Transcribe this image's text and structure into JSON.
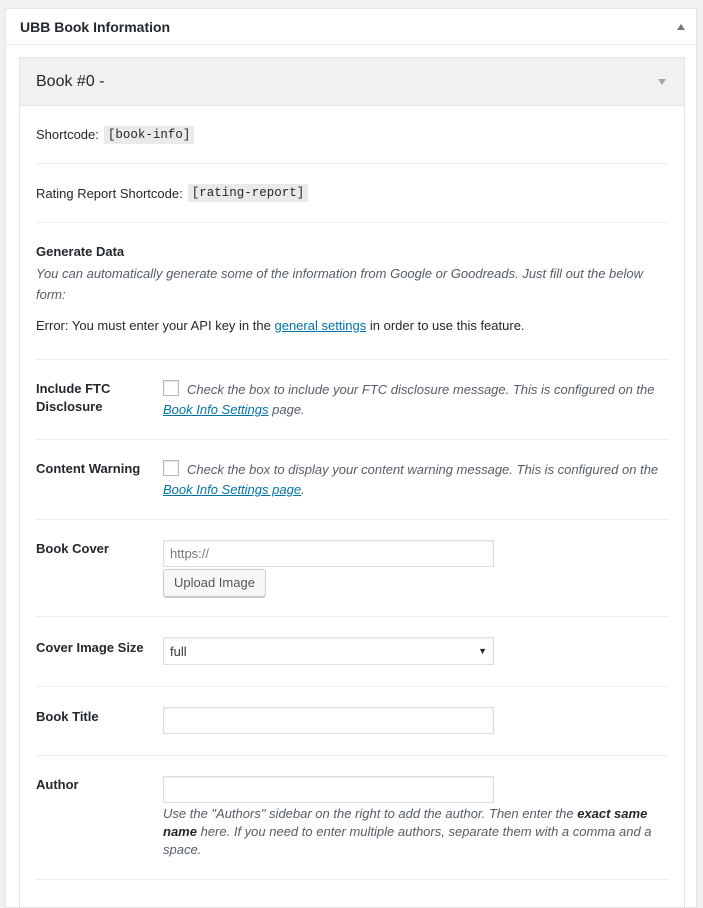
{
  "metabox": {
    "title": "UBB Book Information"
  },
  "book": {
    "header": "Book #0 -"
  },
  "shortcode": {
    "label": "Shortcode:",
    "code": "[book-info]"
  },
  "rating_shortcode": {
    "label": "Rating Report Shortcode:",
    "code": "[rating-report]"
  },
  "generate": {
    "title": "Generate Data",
    "description": "You can automatically generate some of the information from Google or Goodreads. Just fill out the below form:",
    "error_prefix": "Error: You must enter your API key in the",
    "error_link": "general settings",
    "error_suffix": "in order to use this feature."
  },
  "ftc": {
    "label": "Include FTC Disclosure",
    "desc_prefix": "Check the box to include your FTC disclosure message. This is configured on the",
    "link": "Book Info Settings",
    "desc_suffix": "page."
  },
  "content_warning": {
    "label": "Content Warning",
    "desc_prefix": "Check the box to display your content warning message. This is configured on the",
    "link": "Book Info Settings page",
    "desc_suffix": "."
  },
  "cover": {
    "label": "Book Cover",
    "placeholder": "https://",
    "upload_button": "Upload Image"
  },
  "cover_size": {
    "label": "Cover Image Size",
    "selected": "full"
  },
  "title_field": {
    "label": "Book Title",
    "value": ""
  },
  "author": {
    "label": "Author",
    "value": "",
    "desc_1": "Use the \"Authors\" sidebar on the right to add the author. Then enter the",
    "desc_bold": "exact same name",
    "desc_2": "here. If you need to enter multiple authors, separate them with a comma and a space."
  }
}
